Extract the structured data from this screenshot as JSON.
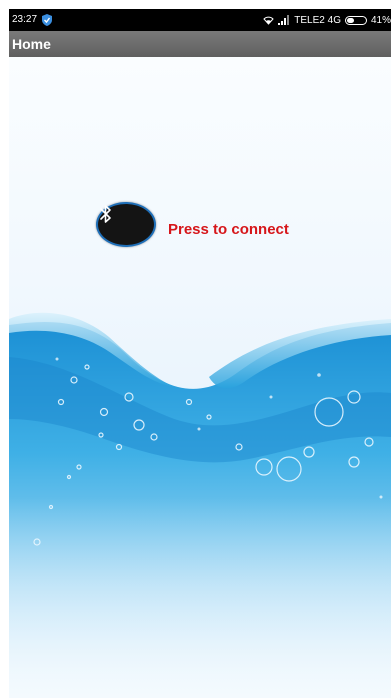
{
  "status_bar": {
    "time": "23:27",
    "carrier": "TELE2 4G",
    "battery": "41%",
    "battery_level": 0.41,
    "shield_icon": "shield-icon",
    "wifi_icon": "wifi-icon",
    "signal_icon": "signal-icon"
  },
  "action_bar": {
    "title": "Home"
  },
  "main": {
    "connect_icon": "bluetooth-icon",
    "connect_label": "Press to connect"
  },
  "colors": {
    "status_bar_bg": "#000000",
    "action_bar_bg": "#6b6b6b",
    "connect_label": "#d6161a",
    "connect_button_bg": "#141414",
    "connect_button_border": "#1f6fb8",
    "water_blue": "#2aa3de"
  }
}
